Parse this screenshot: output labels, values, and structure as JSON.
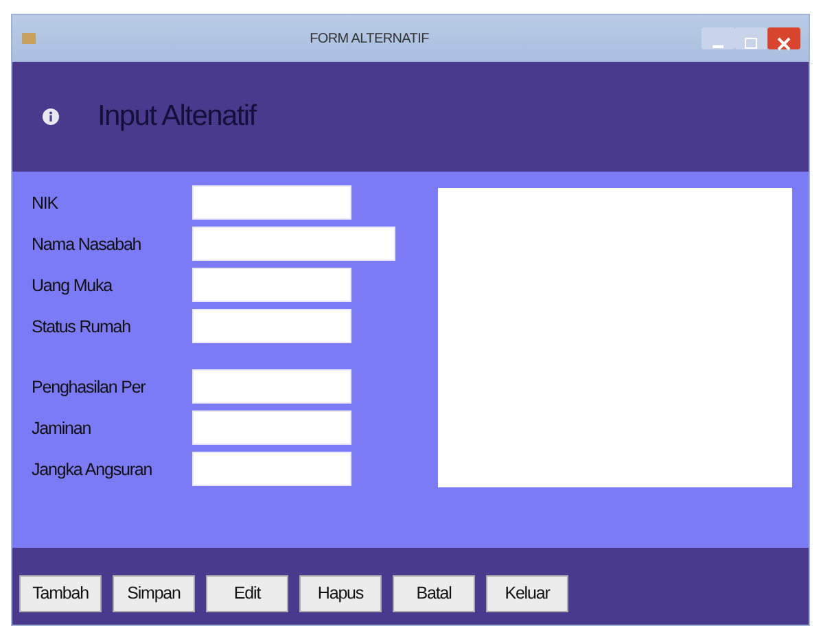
{
  "window": {
    "title": "FORM ALTERNATIF"
  },
  "header": {
    "title": "Input Altenatif"
  },
  "fields": [
    {
      "label": "NIK"
    },
    {
      "label": "Nama Nasabah"
    },
    {
      "label": "Uang Muka"
    },
    {
      "label": "Status Rumah"
    },
    {
      "label": "Penghasilan Per"
    },
    {
      "label": "Jaminan"
    },
    {
      "label": "Jangka Angsuran"
    }
  ],
  "buttons": [
    "Tambah",
    "Simpan",
    "Edit",
    "Hapus",
    "Batal",
    "Keluar"
  ]
}
